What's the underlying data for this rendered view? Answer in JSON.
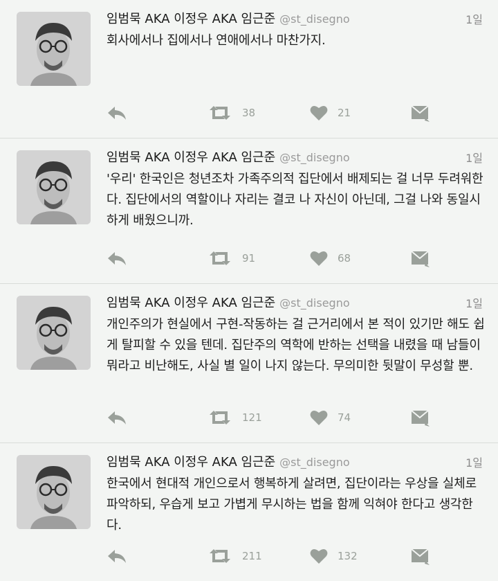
{
  "tweets": [
    {
      "name": "임범묵 AKA 이정우 AKA 임근준",
      "handle": "@st_disegno",
      "time": "1일",
      "text": "회사에서나 집에서나 연애에서나 마찬가지.",
      "retweets": "38",
      "likes": "21"
    },
    {
      "name": "임범묵 AKA 이정우 AKA 임근준",
      "handle": "@st_disegno",
      "time": "1일",
      "text": "'우리' 한국인은 청년조차 가족주의적 집단에서 배제되는 걸 너무 두려워한다. 집단에서의 역할이나 자리는 결코 나 자신이 아닌데, 그걸 나와 동일시하게 배웠으니까.",
      "retweets": "91",
      "likes": "68"
    },
    {
      "name": "임범묵 AKA 이정우 AKA 임근준",
      "handle": "@st_disegno",
      "time": "1일",
      "text": "개인주의가 현실에서 구현-작동하는 걸 근거리에서 본 적이 있기만 해도 쉽게 탈피할 수 있을 텐데. 집단주의 역학에 반하는 선택을 내렸을 때 남들이 뭐라고 비난해도, 사실 별 일이 나지 않는다. 무의미한 뒷말이 무성할 뿐.",
      "retweets": "121",
      "likes": "74"
    },
    {
      "name": "임범묵 AKA 이정우 AKA 임근준",
      "handle": "@st_disegno",
      "time": "1일",
      "text": "한국에서 현대적 개인으로서 행복하게 살려면, 집단이라는 우상을 실체로 파악하되, 우습게 보고 가볍게 무시하는 법을 함께 익혀야 한다고 생각한다.",
      "retweets": "211",
      "likes": "132"
    }
  ],
  "icons": {
    "reply": "reply-icon",
    "retweet": "retweet-icon",
    "like": "heart-icon",
    "dm": "direct-message-icon"
  },
  "colors": {
    "background": "#f3f5f3",
    "icon": "#9aa09a",
    "divider": "#d9dcd9"
  }
}
